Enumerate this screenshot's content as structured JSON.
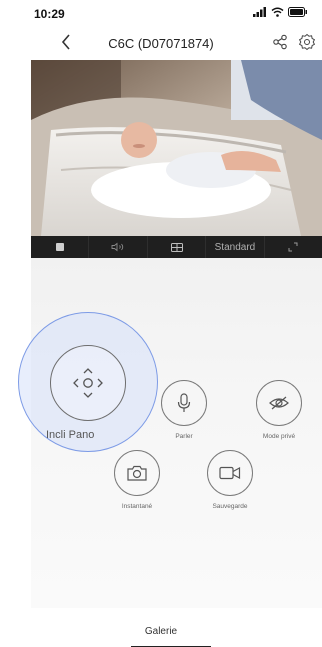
{
  "status": {
    "time": "10:29"
  },
  "header": {
    "title": "C6C (D07071874)"
  },
  "icons": {
    "back": "chevron-left-icon",
    "share": "share-icon",
    "settings": "gear-icon",
    "stop": "stop-icon",
    "sound": "speaker-muted-icon",
    "split": "split-screen-icon",
    "fullscreen": "fullscreen-icon",
    "ptz": "ptz-directional-icon",
    "talk": "microphone-icon",
    "privacy": "eye-off-icon",
    "snapshot": "camera-icon",
    "record": "video-camera-icon"
  },
  "toolbar": {
    "quality_label": "Standard"
  },
  "controls": {
    "ptz_label": "Incli Pano",
    "talk_label": "Parler",
    "privacy_label": "Mode privé",
    "snapshot_label": "Instantané",
    "record_label": "Sauvegarde"
  },
  "bottom": {
    "gallery_label": "Galerie"
  },
  "colors": {
    "highlight_border": "#7d9be6",
    "toolbar_bg": "#1f1f1f"
  }
}
